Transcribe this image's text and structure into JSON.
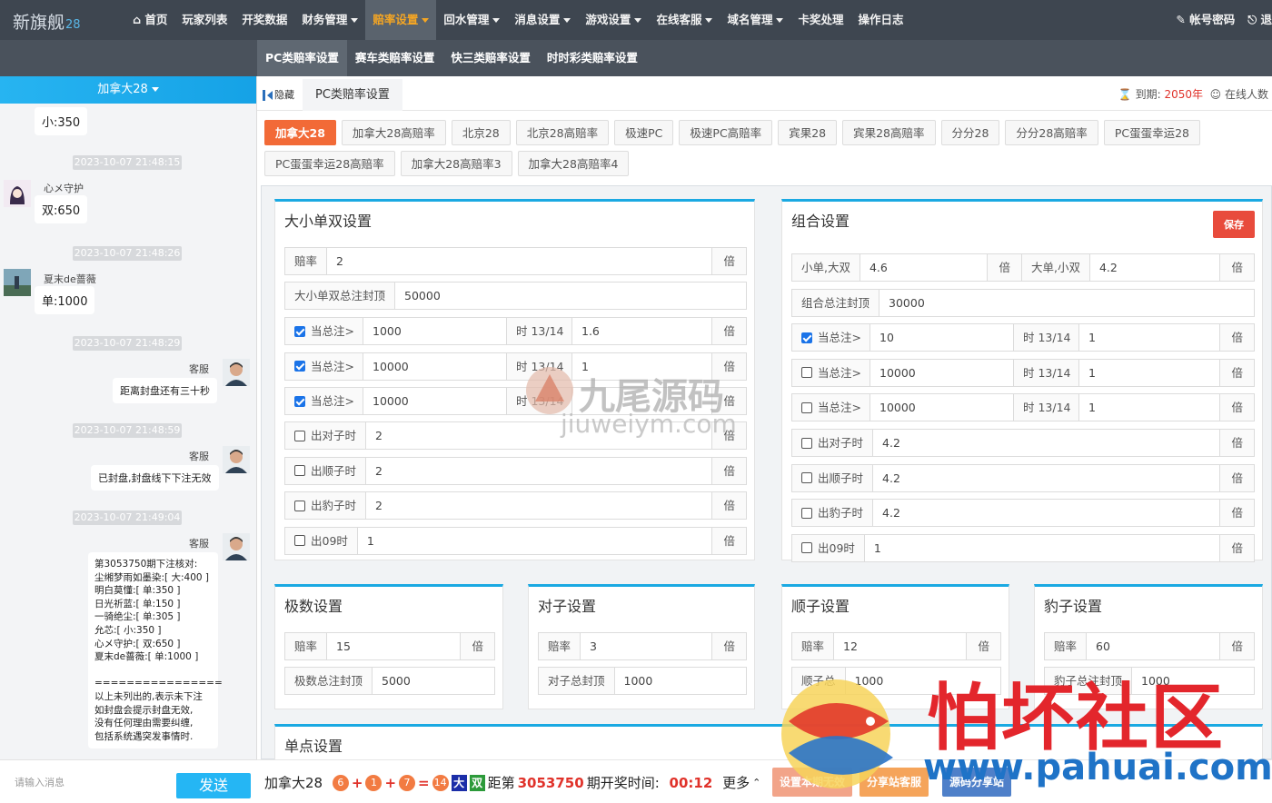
{
  "brand": {
    "name": "新旗舰",
    "num": "28"
  },
  "nav": {
    "items": [
      {
        "label": "首页",
        "icon": "home-icon",
        "caret": false
      },
      {
        "label": "玩家列表",
        "caret": false
      },
      {
        "label": "开奖数据",
        "caret": false
      },
      {
        "label": "财务管理",
        "caret": true
      },
      {
        "label": "赔率设置",
        "caret": true,
        "active": true
      },
      {
        "label": "回水管理",
        "caret": true
      },
      {
        "label": "消息设置",
        "caret": true
      },
      {
        "label": "游戏设置",
        "caret": true
      },
      {
        "label": "在线客服",
        "caret": true
      },
      {
        "label": "域名管理",
        "caret": true
      },
      {
        "label": "卡奖处理",
        "caret": false
      },
      {
        "label": "操作日志",
        "caret": false
      }
    ],
    "right": {
      "account": "帐号密码",
      "logout": "退"
    }
  },
  "subnav": [
    "PC类赔率设置",
    "赛车类赔率设置",
    "快三类赔率设置",
    "时时彩类赔率设置"
  ],
  "chat": {
    "header": "加拿大28",
    "messages": {
      "m0": "小:350",
      "t1": "2023-10-07 21:48:15",
      "u1": "心メ守护",
      "m1": "双:650",
      "t2": "2023-10-07 21:48:26",
      "u2": "夏末de蔷薇",
      "m2": "单:1000",
      "t3": "2023-10-07 21:48:29",
      "u3": "客服",
      "m3": "距离封盘还有三十秒",
      "t4": "2023-10-07 21:48:59",
      "u4": "客服",
      "m4": "已封盘,封盘线下下注无效",
      "t5": "2023-10-07 21:49:04",
      "u5": "客服",
      "m5": "第3053750期下注核对:\n尘缃梦雨如墨染:[ 大:400 ]\n明白莫懂:[ 单:350 ]\n日光祈蓝:[ 单:150 ]\n一骑绝尘:[ 单:305 ]\n允芯:[ 小:350 ]\n心メ守护:[ 双:650 ]\n夏末de蔷薇:[ 单:1000 ]\n\n================\n以上未列出的,表示未下注\n如封盘会提示封盘无效,\n没有任何理由需要纠缠,\n包括系统遇突发事情时."
    },
    "input_placeholder": "请输入消息",
    "send": "发送"
  },
  "tabs": {
    "hide": "隐藏",
    "current": "PC类赔率设置"
  },
  "expire": {
    "label": "到期:",
    "year": "2050年",
    "online": "在线人数"
  },
  "lotteries": [
    "加拿大28",
    "加拿大28高赔率",
    "北京28",
    "北京28高赔率",
    "极速PC",
    "极速PC高赔率",
    "宾果28",
    "宾果28高赔率",
    "分分28",
    "分分28高赔率",
    "PC蛋蛋幸运28",
    "PC蛋蛋幸运28高赔率",
    "加拿大28高赔率3",
    "加拿大28高赔率4"
  ],
  "size": {
    "title": "大小单双设置",
    "odds_label": "赔率",
    "odds": "2",
    "unit": "倍",
    "cap_label": "大小单双总注封顶",
    "cap": "50000",
    "rules": [
      {
        "checked": true,
        "label": "当总注>",
        "amount": "1000",
        "when": "时 13/14",
        "val": "1.6"
      },
      {
        "checked": true,
        "label": "当总注>",
        "amount": "10000",
        "when": "时 13/14",
        "val": "1"
      },
      {
        "checked": true,
        "label": "当总注>",
        "amount": "10000",
        "when": "时 13/14",
        "val": ""
      }
    ],
    "extras": [
      {
        "label": "出对子时",
        "val": "2"
      },
      {
        "label": "出顺子时",
        "val": "2"
      },
      {
        "label": "出豹子时",
        "val": "2"
      },
      {
        "label": "出09时",
        "val": "1"
      }
    ]
  },
  "combo": {
    "title": "组合设置",
    "save": "保存",
    "a_label": "小单,大双",
    "a": "4.6",
    "b_label": "大单,小双",
    "b": "4.2",
    "unit": "倍",
    "cap_label": "组合总注封顶",
    "cap": "30000",
    "rules": [
      {
        "checked": true,
        "label": "当总注>",
        "amount": "10",
        "when": "时 13/14",
        "val": "1"
      },
      {
        "checked": false,
        "label": "当总注>",
        "amount": "10000",
        "when": "时 13/14",
        "val": "1"
      },
      {
        "checked": false,
        "label": "当总注>",
        "amount": "10000",
        "when": "时 13/14",
        "val": "1"
      }
    ],
    "extras": [
      {
        "label": "出对子时",
        "val": "4.2"
      },
      {
        "label": "出顺子时",
        "val": "4.2"
      },
      {
        "label": "出豹子时",
        "val": "4.2"
      },
      {
        "label": "出09时",
        "val": "1"
      }
    ]
  },
  "extreme": {
    "title": "极数设置",
    "odds_label": "赔率",
    "odds": "15",
    "unit": "倍",
    "cap_label": "极数总注封顶",
    "cap": "5000"
  },
  "pair": {
    "title": "对子设置",
    "odds_label": "赔率",
    "odds": "3",
    "unit": "倍",
    "cap_label": "对子总封顶",
    "cap": "1000"
  },
  "straight": {
    "title": "顺子设置",
    "odds_label": "赔率",
    "odds": "12",
    "unit": "倍",
    "cap_label": "顺子总",
    "cap": "1000"
  },
  "leopard": {
    "title": "豹子设置",
    "odds_label": "赔率",
    "odds": "60",
    "unit": "倍",
    "cap_label": "豹子总注封顶",
    "cap": "1000"
  },
  "single": {
    "title": "单点设置"
  },
  "bottom": {
    "game": "加拿大28",
    "b1": "6",
    "b2": "1",
    "b3": "7",
    "sum": "14",
    "big": "大",
    "even": "双",
    "pre": "距第",
    "issue": "3053750",
    "post": "期开奖时间:",
    "countdown": "00:12",
    "more": "更多",
    "btn1": "设置本期无效",
    "btn2": "分享站客服",
    "btn3": "源码分享站"
  },
  "watermarks": {
    "w1a": "九尾源码",
    "w1b": "jiuweiym.com",
    "w2a": "怕坏社区",
    "w2b": "www.pahuai.com"
  }
}
